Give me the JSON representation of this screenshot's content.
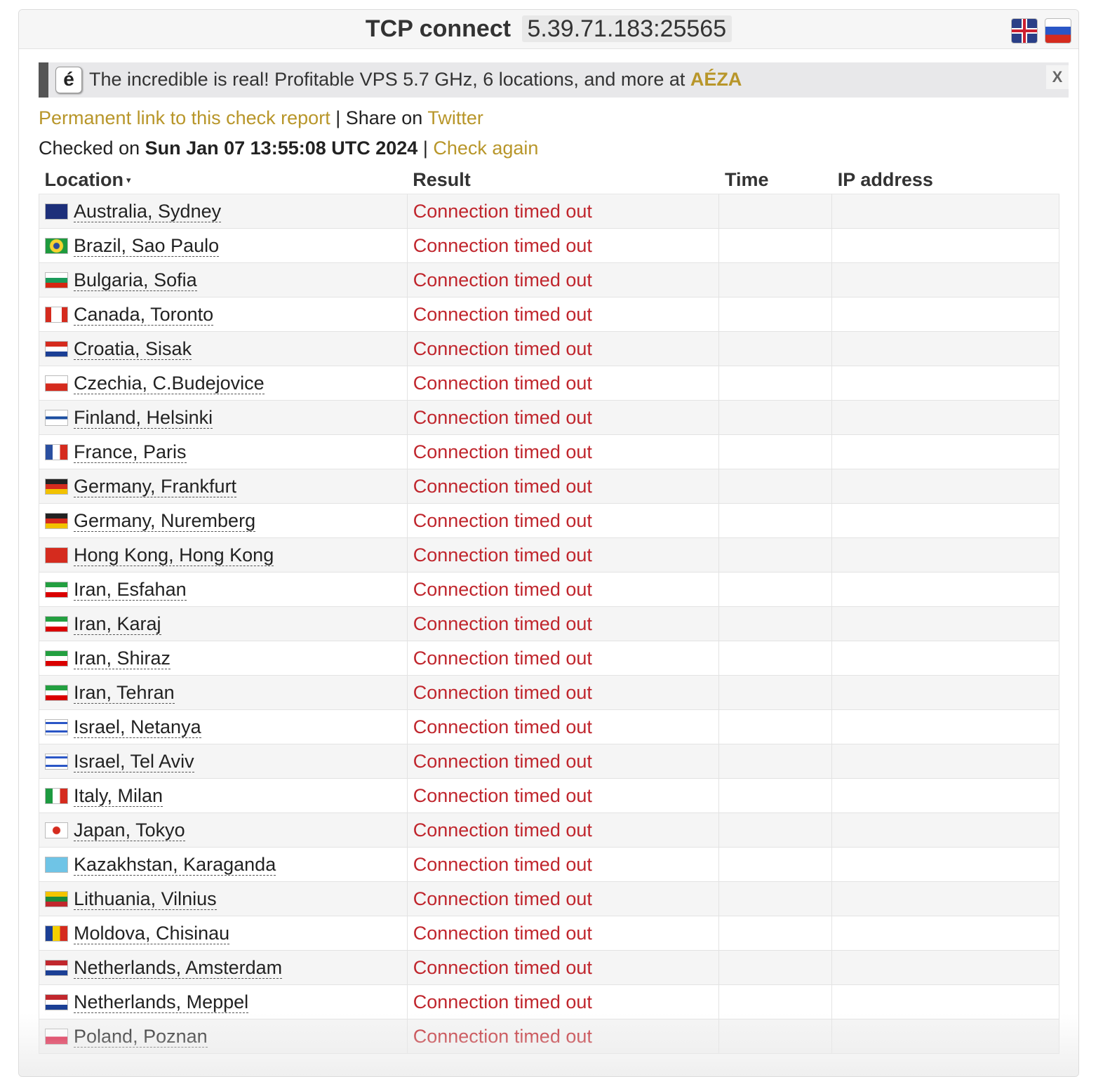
{
  "header": {
    "title": "TCP connect",
    "host": "5.39.71.183:25565",
    "languages": [
      {
        "name": "English",
        "icon": "uk-flag-icon"
      },
      {
        "name": "Russian",
        "icon": "russia-flag-icon"
      }
    ]
  },
  "banner": {
    "logo_char": "é",
    "text": "The incredible is real! Profitable VPS 5.7 GHz, 6 locations, and more at ",
    "link_text": "AÉZA",
    "close": "X"
  },
  "links": {
    "permanent": "Permanent link to this check report",
    "separator": " | ",
    "share_prefix": "Share on ",
    "twitter": "Twitter"
  },
  "checked": {
    "prefix": "Checked on ",
    "date": "Sun Jan 07 13:55:08 UTC 2024",
    "separator": " | ",
    "again": "Check again"
  },
  "table": {
    "columns": [
      "Location",
      "Result",
      "Time",
      "IP address"
    ],
    "sort_indicator": "▾",
    "rows": [
      {
        "location": "Australia, Sydney",
        "flag": "au",
        "result": "Connection timed out"
      },
      {
        "location": "Brazil, Sao Paulo",
        "flag": "br",
        "result": "Connection timed out"
      },
      {
        "location": "Bulgaria, Sofia",
        "flag": "bg",
        "result": "Connection timed out"
      },
      {
        "location": "Canada, Toronto",
        "flag": "ca",
        "result": "Connection timed out"
      },
      {
        "location": "Croatia, Sisak",
        "flag": "hr",
        "result": "Connection timed out"
      },
      {
        "location": "Czechia, C.Budejovice",
        "flag": "cz",
        "result": "Connection timed out"
      },
      {
        "location": "Finland, Helsinki",
        "flag": "fi",
        "result": "Connection timed out"
      },
      {
        "location": "France, Paris",
        "flag": "fr",
        "result": "Connection timed out"
      },
      {
        "location": "Germany, Frankfurt",
        "flag": "de",
        "result": "Connection timed out"
      },
      {
        "location": "Germany, Nuremberg",
        "flag": "de",
        "result": "Connection timed out"
      },
      {
        "location": "Hong Kong, Hong Kong",
        "flag": "hk",
        "result": "Connection timed out"
      },
      {
        "location": "Iran, Esfahan",
        "flag": "ir",
        "result": "Connection timed out"
      },
      {
        "location": "Iran, Karaj",
        "flag": "ir",
        "result": "Connection timed out"
      },
      {
        "location": "Iran, Shiraz",
        "flag": "ir",
        "result": "Connection timed out"
      },
      {
        "location": "Iran, Tehran",
        "flag": "ir",
        "result": "Connection timed out"
      },
      {
        "location": "Israel, Netanya",
        "flag": "il",
        "result": "Connection timed out"
      },
      {
        "location": "Israel, Tel Aviv",
        "flag": "il",
        "result": "Connection timed out"
      },
      {
        "location": "Italy, Milan",
        "flag": "it",
        "result": "Connection timed out"
      },
      {
        "location": "Japan, Tokyo",
        "flag": "jp",
        "result": "Connection timed out"
      },
      {
        "location": "Kazakhstan, Karaganda",
        "flag": "kz",
        "result": "Connection timed out"
      },
      {
        "location": "Lithuania, Vilnius",
        "flag": "lt",
        "result": "Connection timed out"
      },
      {
        "location": "Moldova, Chisinau",
        "flag": "md",
        "result": "Connection timed out"
      },
      {
        "location": "Netherlands, Amsterdam",
        "flag": "nl",
        "result": "Connection timed out"
      },
      {
        "location": "Netherlands, Meppel",
        "flag": "nl",
        "result": "Connection timed out"
      },
      {
        "location": "Poland, Poznan",
        "flag": "pl",
        "result": "Connection timed out"
      }
    ]
  },
  "colors": {
    "link": "#b8962a",
    "error": "#c0262d",
    "banner_bg": "#e8e8ea"
  }
}
